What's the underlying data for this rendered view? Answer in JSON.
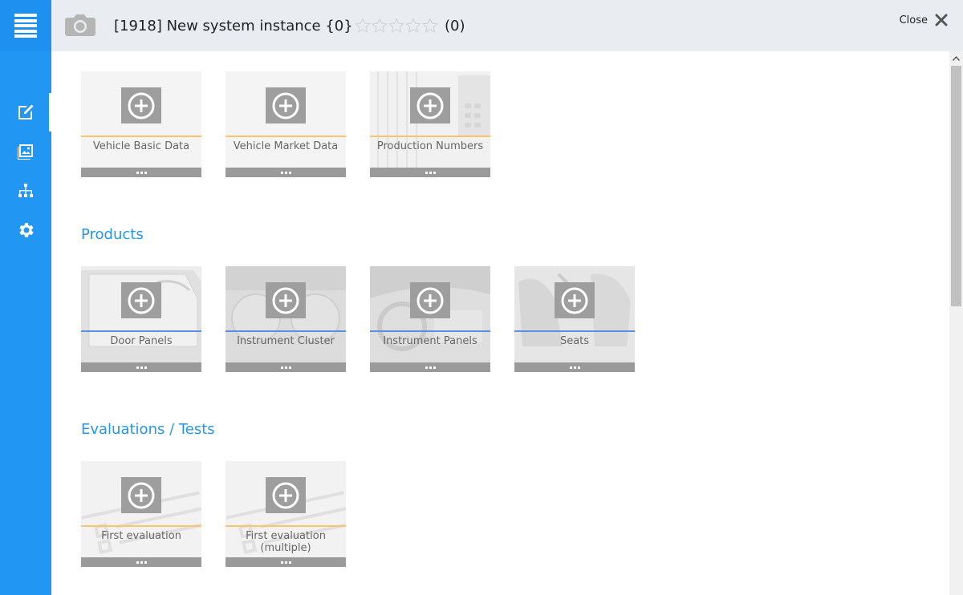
{
  "header": {
    "title": "[1918] New system instance {0}",
    "rating_count": "(0)",
    "stars": 5,
    "close_label": "Close"
  },
  "sidebar": {
    "items": [
      {
        "icon": "edit-icon"
      },
      {
        "icon": "image-icon"
      },
      {
        "icon": "hierarchy-icon"
      },
      {
        "icon": "gear-icon"
      }
    ]
  },
  "groups": [
    {
      "title": "",
      "tiles": [
        {
          "label": "Vehicle Basic Data",
          "accent": "orange"
        },
        {
          "label": "Vehicle Market Data",
          "accent": "orange"
        },
        {
          "label": "Production Numbers",
          "accent": "orange"
        }
      ]
    },
    {
      "title": "Products",
      "tiles": [
        {
          "label": "Door Panels",
          "accent": "blue"
        },
        {
          "label": "Instrument Cluster",
          "accent": "blue"
        },
        {
          "label": "Instrument Panels",
          "accent": "blue"
        },
        {
          "label": "Seats",
          "accent": "blue"
        }
      ]
    },
    {
      "title": "Evaluations / Tests",
      "tiles": [
        {
          "label": "First evaluation",
          "accent": "orange"
        },
        {
          "label": "First evaluation\n(multiple)",
          "accent": "orange"
        }
      ]
    }
  ],
  "colors": {
    "sidebar": "#2196f3",
    "accent_text": "#2196f3",
    "header_bg": "#e9edf2",
    "orange_line": "#ffc46b",
    "blue_line": "#5b8fe0"
  }
}
